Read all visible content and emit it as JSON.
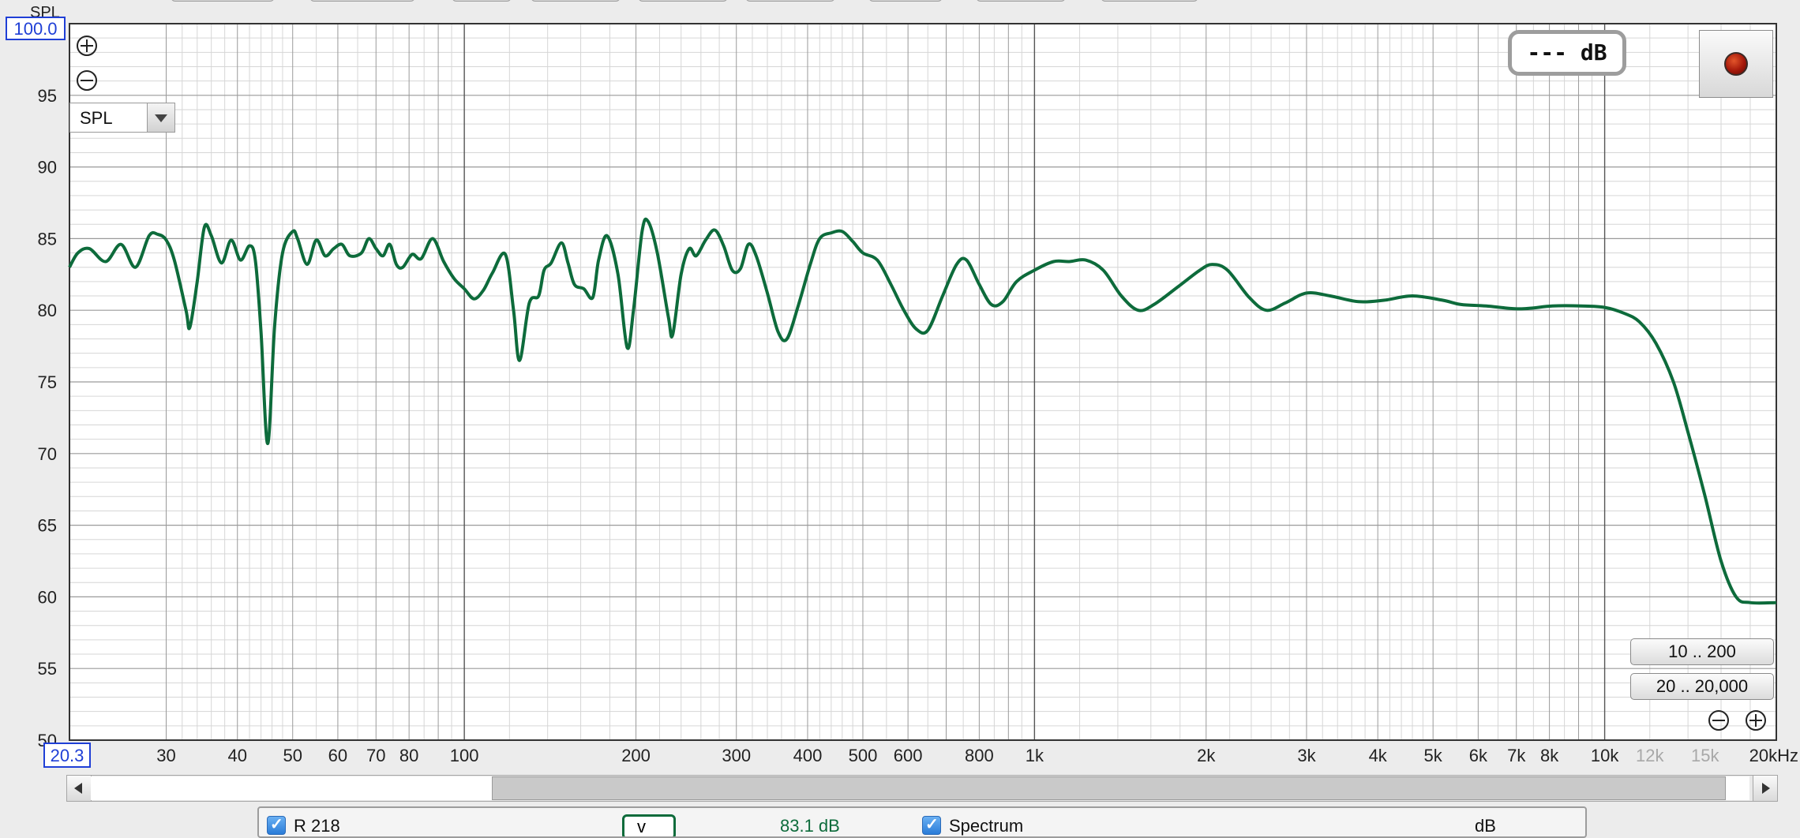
{
  "window": {
    "top_tabs": [
      "",
      "",
      "",
      "",
      "",
      "",
      "",
      "",
      ""
    ]
  },
  "controls": {
    "zoom_in_icon": "circle-plus-icon",
    "zoom_out_icon": "circle-minus-icon",
    "graph_type": "SPL",
    "readout": "--- dB",
    "record_button": "record-icon",
    "range_buttons": [
      "10 .. 200",
      "20 .. 20,000"
    ],
    "h_zoom_out_icon": "circle-minus-icon",
    "h_zoom_in_icon": "circle-plus-icon"
  },
  "colors": {
    "trace": "#0d6b3b",
    "axis_box": "#1f3fd6",
    "grid_major": "#9a9a9a",
    "grid_minor": "#d6d6d6",
    "grid_decade": "#555555"
  },
  "chart_data": {
    "type": "line",
    "ylabel": "SPL",
    "x_scale": "log",
    "xlim": [
      20.3,
      20000
    ],
    "ylim": [
      50,
      100
    ],
    "y_max_label": "100.0",
    "x_min_label": "20.3",
    "y_ticks": [
      "95",
      "90",
      "85",
      "80",
      "75",
      "70",
      "65",
      "60",
      "55",
      "50"
    ],
    "x_ticks": [
      {
        "v": 30,
        "label": "30"
      },
      {
        "v": 40,
        "label": "40"
      },
      {
        "v": 50,
        "label": "50"
      },
      {
        "v": 60,
        "label": "60"
      },
      {
        "v": 70,
        "label": "70"
      },
      {
        "v": 80,
        "label": "80"
      },
      {
        "v": 100,
        "label": "100"
      },
      {
        "v": 200,
        "label": "200"
      },
      {
        "v": 300,
        "label": "300"
      },
      {
        "v": 400,
        "label": "400"
      },
      {
        "v": 500,
        "label": "500"
      },
      {
        "v": 600,
        "label": "600"
      },
      {
        "v": 800,
        "label": "800"
      },
      {
        "v": 1000,
        "label": "1k"
      },
      {
        "v": 2000,
        "label": "2k"
      },
      {
        "v": 3000,
        "label": "3k"
      },
      {
        "v": 4000,
        "label": "4k"
      },
      {
        "v": 5000,
        "label": "5k"
      },
      {
        "v": 6000,
        "label": "6k"
      },
      {
        "v": 7000,
        "label": "7k"
      },
      {
        "v": 8000,
        "label": "8k"
      },
      {
        "v": 10000,
        "label": "10k"
      }
    ],
    "x_ticks_grey": [
      {
        "v": 12000,
        "label": "12k"
      },
      {
        "v": 15000,
        "label": "15k"
      }
    ],
    "x_end_label": "20kHz",
    "grid": true,
    "series": [
      {
        "values": [
          [
            20.3,
            83.0
          ],
          [
            21,
            84.0
          ],
          [
            22,
            84.3
          ],
          [
            23.5,
            83.4
          ],
          [
            25,
            84.6
          ],
          [
            26.5,
            83.0
          ],
          [
            28,
            85.2
          ],
          [
            29,
            85.3
          ],
          [
            30,
            84.9
          ],
          [
            31,
            83.5
          ],
          [
            32.5,
            80.0
          ],
          [
            33,
            78.8
          ],
          [
            34,
            82.0
          ],
          [
            35,
            85.8
          ],
          [
            36,
            85.2
          ],
          [
            37.5,
            83.3
          ],
          [
            39,
            84.9
          ],
          [
            40.5,
            83.5
          ],
          [
            42,
            84.5
          ],
          [
            43,
            83.5
          ],
          [
            44,
            78.5
          ],
          [
            45.2,
            70.7
          ],
          [
            46.5,
            79.0
          ],
          [
            48,
            84.0
          ],
          [
            50,
            85.5
          ],
          [
            51,
            85.0
          ],
          [
            53,
            83.2
          ],
          [
            55,
            84.9
          ],
          [
            57,
            83.8
          ],
          [
            59,
            84.3
          ],
          [
            61,
            84.6
          ],
          [
            63,
            83.8
          ],
          [
            66,
            84.0
          ],
          [
            68,
            85.0
          ],
          [
            70,
            84.3
          ],
          [
            72,
            83.8
          ],
          [
            74,
            84.6
          ],
          [
            76,
            83.2
          ],
          [
            78,
            83.0
          ],
          [
            81,
            83.9
          ],
          [
            84,
            83.6
          ],
          [
            88,
            85.0
          ],
          [
            92,
            83.4
          ],
          [
            96,
            82.2
          ],
          [
            100,
            81.5
          ],
          [
            104,
            80.8
          ],
          [
            108,
            81.4
          ],
          [
            112,
            82.6
          ],
          [
            118,
            83.9
          ],
          [
            122,
            80.0
          ],
          [
            125,
            76.5
          ],
          [
            130,
            80.5
          ],
          [
            135,
            81.0
          ],
          [
            138,
            82.8
          ],
          [
            142,
            83.3
          ],
          [
            148,
            84.7
          ],
          [
            152,
            83.3
          ],
          [
            156,
            81.8
          ],
          [
            162,
            81.5
          ],
          [
            168,
            80.9
          ],
          [
            172,
            83.5
          ],
          [
            178,
            85.2
          ],
          [
            186,
            82.5
          ],
          [
            193,
            77.4
          ],
          [
            198,
            80.0
          ],
          [
            205,
            85.5
          ],
          [
            210,
            86.2
          ],
          [
            218,
            84.0
          ],
          [
            228,
            79.5
          ],
          [
            232,
            78.3
          ],
          [
            240,
            82.5
          ],
          [
            248,
            84.3
          ],
          [
            255,
            83.8
          ],
          [
            265,
            84.9
          ],
          [
            275,
            85.6
          ],
          [
            285,
            84.5
          ],
          [
            295,
            82.8
          ],
          [
            305,
            82.9
          ],
          [
            315,
            84.6
          ],
          [
            325,
            83.8
          ],
          [
            340,
            81.2
          ],
          [
            355,
            78.5
          ],
          [
            368,
            78.0
          ],
          [
            385,
            80.3
          ],
          [
            405,
            83.3
          ],
          [
            420,
            85.0
          ],
          [
            440,
            85.4
          ],
          [
            460,
            85.5
          ],
          [
            480,
            84.8
          ],
          [
            500,
            84.0
          ],
          [
            530,
            83.5
          ],
          [
            560,
            81.8
          ],
          [
            590,
            80.0
          ],
          [
            620,
            78.7
          ],
          [
            650,
            78.6
          ],
          [
            690,
            81.0
          ],
          [
            730,
            83.2
          ],
          [
            760,
            83.5
          ],
          [
            800,
            81.8
          ],
          [
            840,
            80.4
          ],
          [
            880,
            80.6
          ],
          [
            930,
            82.0
          ],
          [
            1000,
            82.8
          ],
          [
            1080,
            83.4
          ],
          [
            1150,
            83.4
          ],
          [
            1230,
            83.5
          ],
          [
            1320,
            82.8
          ],
          [
            1420,
            81.0
          ],
          [
            1520,
            80.0
          ],
          [
            1620,
            80.4
          ],
          [
            1780,
            81.6
          ],
          [
            1950,
            82.8
          ],
          [
            2050,
            83.2
          ],
          [
            2180,
            82.8
          ],
          [
            2380,
            80.9
          ],
          [
            2550,
            80.0
          ],
          [
            2750,
            80.5
          ],
          [
            3000,
            81.2
          ],
          [
            3300,
            81.0
          ],
          [
            3700,
            80.6
          ],
          [
            4100,
            80.7
          ],
          [
            4600,
            81.0
          ],
          [
            5200,
            80.7
          ],
          [
            5600,
            80.4
          ],
          [
            6200,
            80.3
          ],
          [
            7100,
            80.1
          ],
          [
            8100,
            80.3
          ],
          [
            9100,
            80.3
          ],
          [
            10000,
            80.2
          ],
          [
            10800,
            79.8
          ],
          [
            11500,
            79.2
          ],
          [
            12300,
            77.7
          ],
          [
            13200,
            75.0
          ],
          [
            14000,
            71.5
          ],
          [
            15000,
            67.0
          ],
          [
            16000,
            62.5
          ],
          [
            17000,
            60.0
          ],
          [
            18000,
            59.6
          ],
          [
            20000,
            59.6
          ]
        ]
      }
    ]
  },
  "scrollbar": {
    "left_arrow": "left-arrow-icon",
    "right_arrow": "right-arrow-icon"
  },
  "legend": {
    "trace_name": "R 218",
    "dropdown": "v",
    "trace_value": "83.1 dB",
    "spectrum_label": "Spectrum",
    "spectrum_value": "dB"
  }
}
